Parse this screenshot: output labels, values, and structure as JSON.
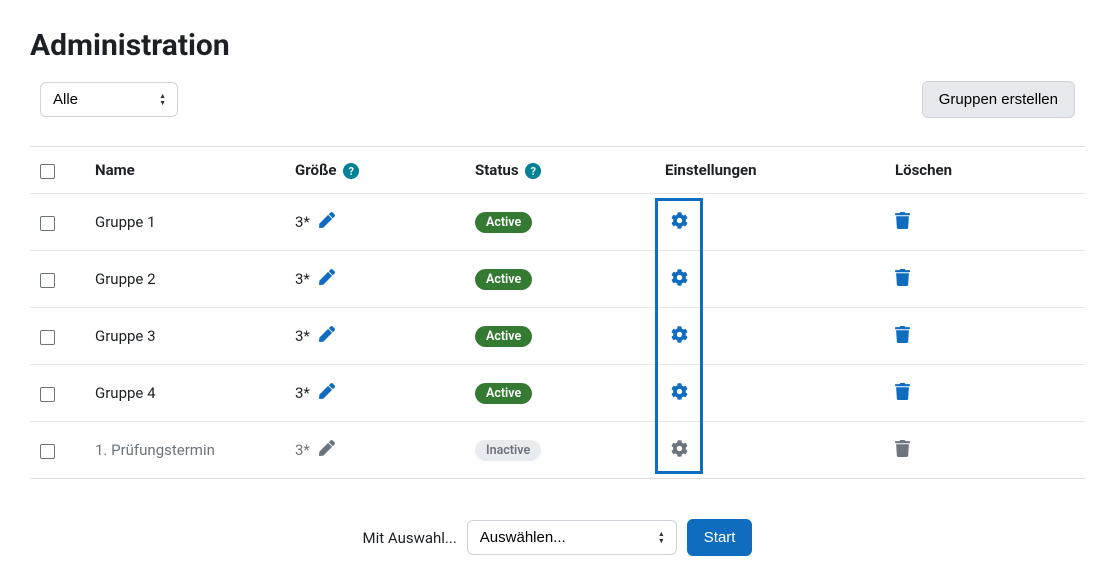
{
  "page_title": "Administration",
  "filter": {
    "selected": "Alle"
  },
  "create_button": "Gruppen erstellen",
  "columns": {
    "name": "Name",
    "size": "Größe",
    "status": "Status",
    "settings": "Einstellungen",
    "delete": "Löschen"
  },
  "rows": [
    {
      "name": "Gruppe 1",
      "size": "3*",
      "status": "Active",
      "active": true
    },
    {
      "name": "Gruppe 2",
      "size": "3*",
      "status": "Active",
      "active": true
    },
    {
      "name": "Gruppe 3",
      "size": "3*",
      "status": "Active",
      "active": true
    },
    {
      "name": "Gruppe 4",
      "size": "3*",
      "status": "Active",
      "active": true
    },
    {
      "name": "1. Prüfungstermin",
      "size": "3*",
      "status": "Inactive",
      "active": false
    }
  ],
  "bulk": {
    "label": "Mit Auswahl...",
    "placeholder": "Auswählen...",
    "start": "Start"
  }
}
